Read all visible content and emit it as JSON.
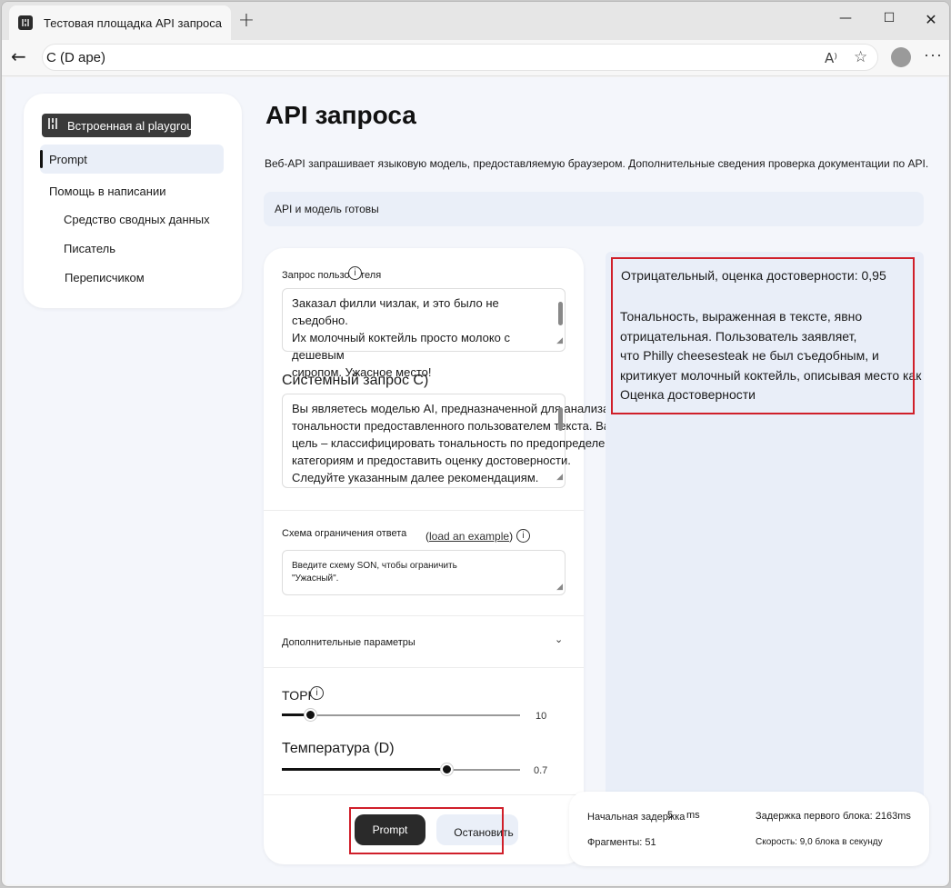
{
  "browser": {
    "tab_title": "Тестовая площадка API запроса",
    "address": "C (D ape)"
  },
  "sidebar": {
    "brand": "Встроенная al playgroun",
    "items": [
      {
        "label": "Prompt"
      },
      {
        "label": "Помощь в написании"
      },
      {
        "label": "Средство сводных данных"
      },
      {
        "label": "Писатель"
      },
      {
        "label": "Переписчиком"
      }
    ]
  },
  "header": {
    "title": "API запроса",
    "description": "Веб-API запрашивает языковую модель, предоставляемую браузером. Дополнительные сведения проверка документации по API.",
    "status": "API и модель готовы"
  },
  "form": {
    "user_prompt_label": "Запрос пользователя",
    "user_prompt_lines": [
      "Заказал филли чизлак, и это было не съедобно.",
      "Их молочный коктейль просто молоко с дешевым",
      "сиропом. Ужасное место!"
    ],
    "system_prompt_label": "Системный запрос C)",
    "system_prompt_lines": [
      "Вы являетесь моделью AI, предназначенной для анализа",
      "тональности предоставленного пользователем текста. Ваша",
      "цель – классифицировать тональность по предопределенным",
      "категориям и предоставить оценку достоверности.",
      "Следуйте указанным далее рекомендациям."
    ],
    "schema_label": "Схема ограничения ответа",
    "schema_link": "load an example",
    "schema_placeholder_lines": [
      "Введите схему SON, чтобы ограничить",
      "\"Ужасный\"."
    ],
    "advanced_label": "Дополнительные параметры",
    "topk": {
      "label": "TOPK",
      "value": "10",
      "fraction": 0.12
    },
    "temperature": {
      "label": "Температура (D)",
      "value": "0.7",
      "fraction": 0.69
    },
    "prompt_button": "Prompt",
    "stop_button": "Остановить"
  },
  "result": {
    "line1": "Отрицательный, оценка достоверности: 0,95",
    "body_lines": [
      "Тональность, выраженная в тексте, явно",
      "отрицательная. Пользователь заявляет,",
      "что Philly cheesesteak не был съедобным, и",
      "критикует молочный коктейль, описывая место как",
      "Оценка достоверности"
    ]
  },
  "stats": {
    "initial_delay_label": "Начальная задержка",
    "initial_delay_value": "5",
    "initial_delay_unit": "ms",
    "first_chunk_label": "Задержка первого блока: 2163ms",
    "fragments": "Фрагменты: 51",
    "speed": "Скорость: 9,0 блока в секунду"
  },
  "colors": {
    "highlight": "#d01f2a",
    "accent_bg": "#eaeff8",
    "button_dark": "#2a2a2a"
  }
}
